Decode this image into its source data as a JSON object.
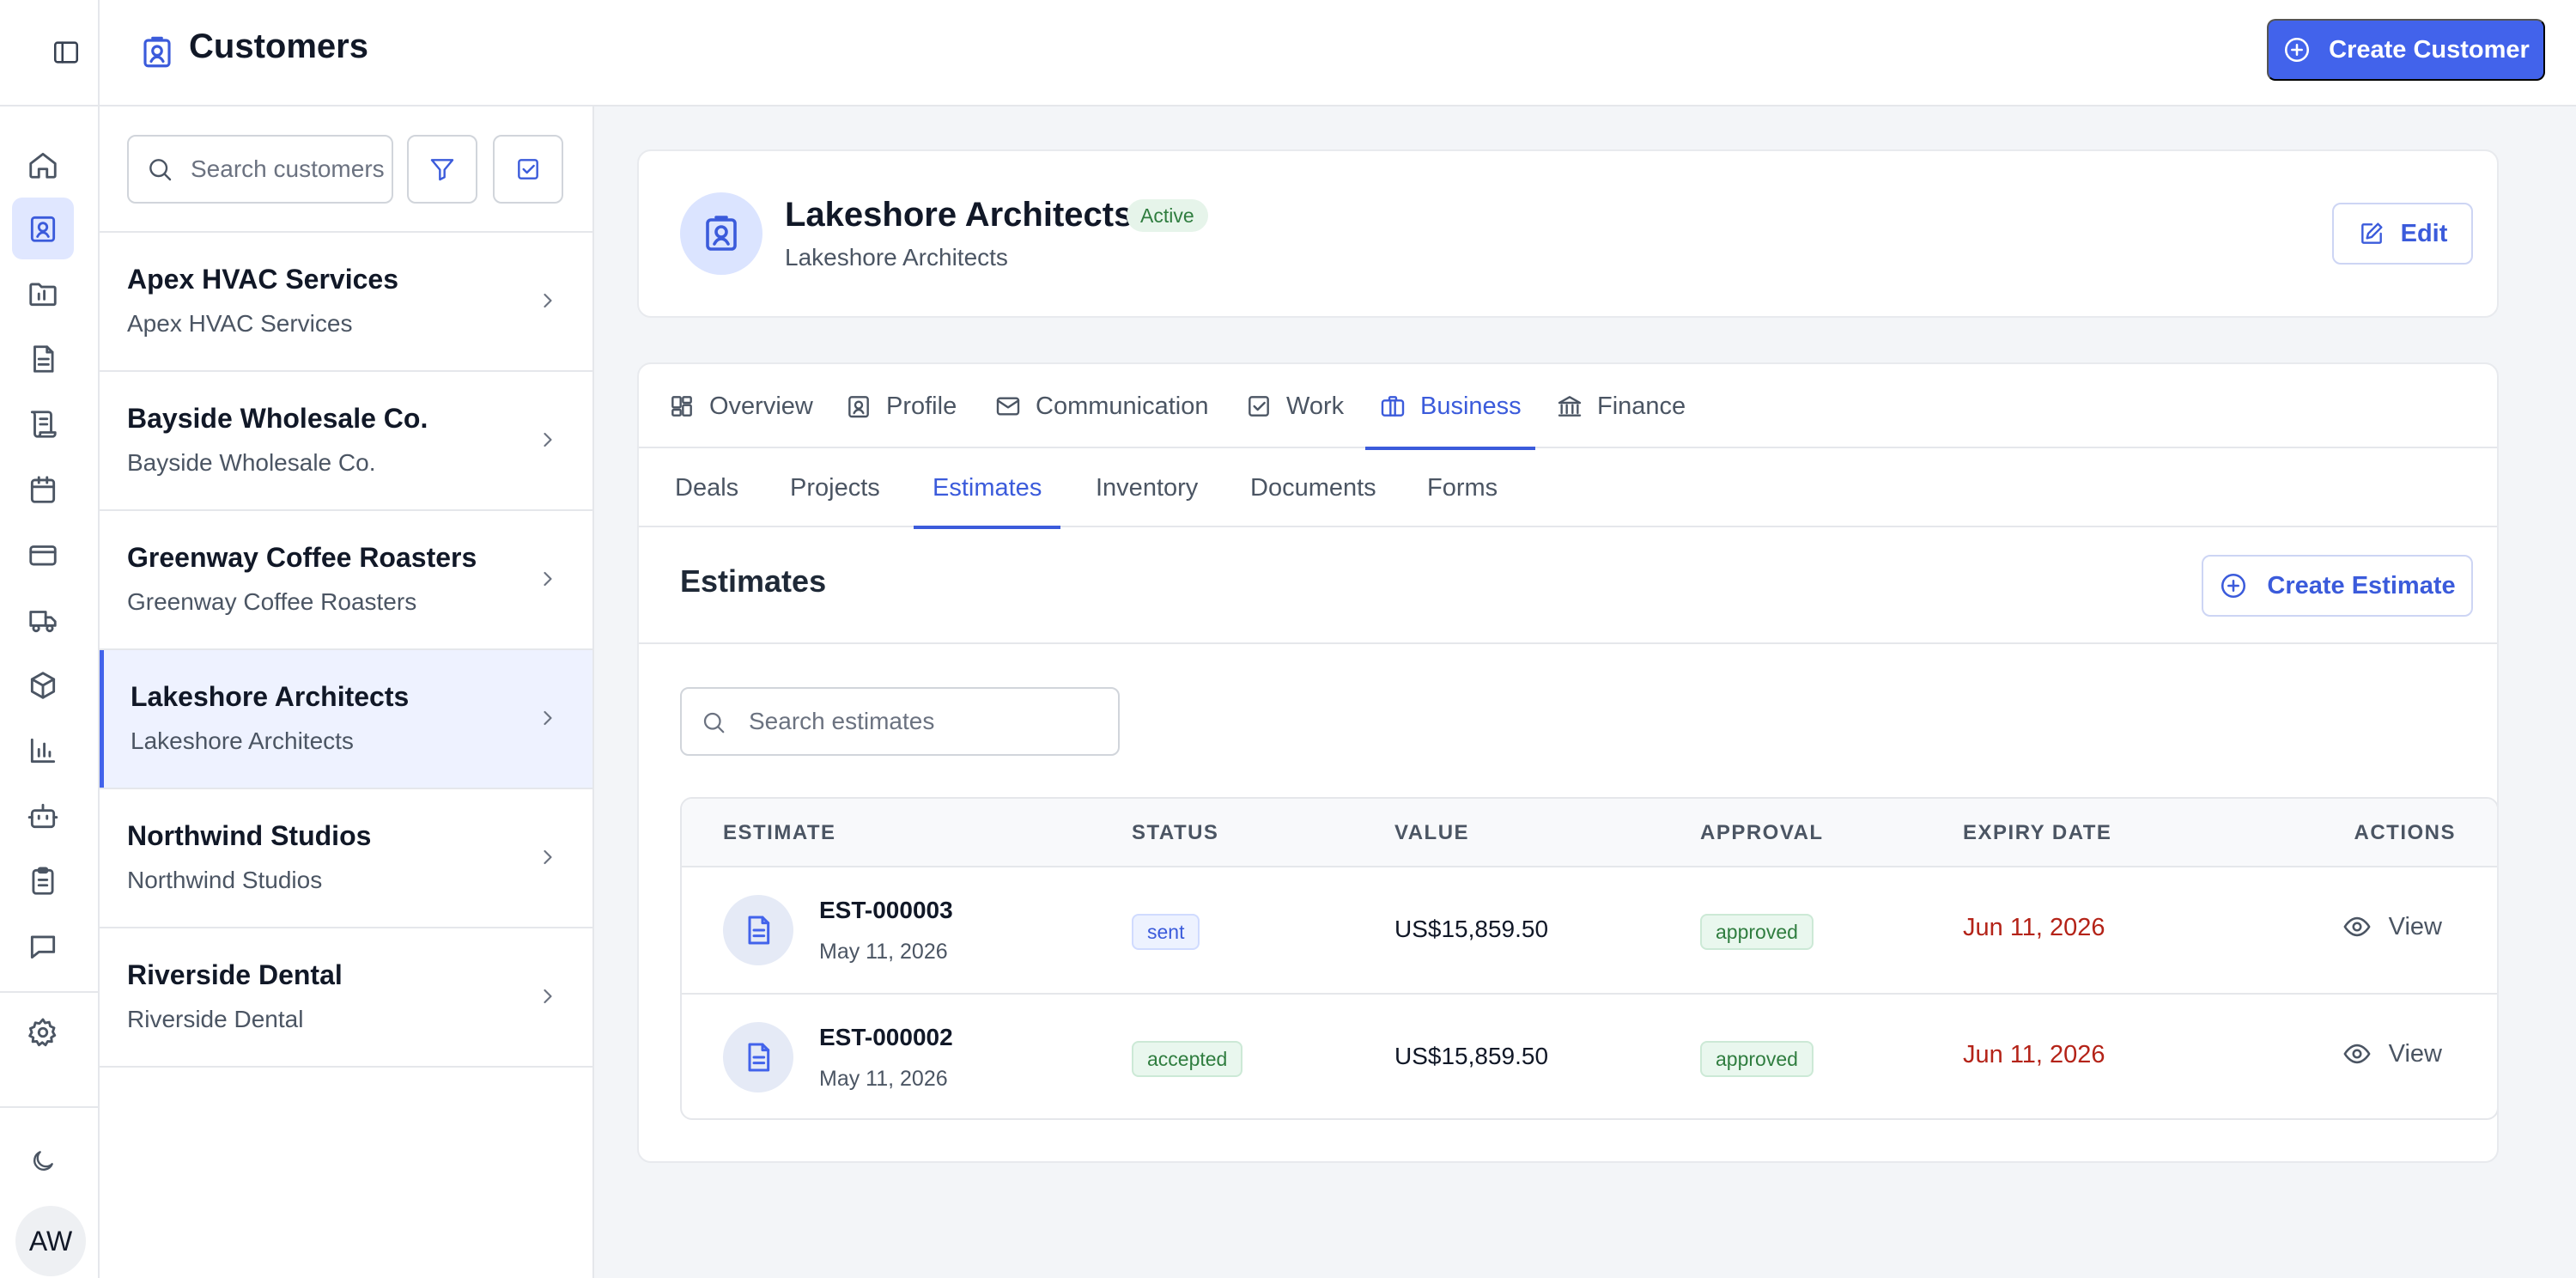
{
  "header": {
    "title": "Customers",
    "create_label": "Create Customer"
  },
  "rail": {
    "items": [
      "home",
      "customers",
      "projects",
      "documents",
      "contracts",
      "calendar",
      "billing",
      "delivery",
      "inventory",
      "reports",
      "automation",
      "tasks",
      "messages"
    ],
    "active": "customers",
    "settings": "settings",
    "theme": "moon-icon",
    "avatar_initials": "AW"
  },
  "customer_list": {
    "search_placeholder": "Search customers",
    "items": [
      {
        "name": "Apex HVAC Services",
        "sub": "Apex HVAC Services"
      },
      {
        "name": "Bayside Wholesale Co.",
        "sub": "Bayside Wholesale Co."
      },
      {
        "name": "Greenway Coffee Roasters",
        "sub": "Greenway Coffee Roasters"
      },
      {
        "name": "Lakeshore Architects",
        "sub": "Lakeshore Architects",
        "active": true
      },
      {
        "name": "Northwind Studios",
        "sub": "Northwind Studios"
      },
      {
        "name": "Riverside Dental",
        "sub": "Riverside Dental"
      }
    ]
  },
  "customer": {
    "name": "Lakeshore Architects",
    "status": "Active",
    "sub": "Lakeshore Architects",
    "edit_label": "Edit"
  },
  "tabs": [
    "Overview",
    "Profile",
    "Communication",
    "Work",
    "Business",
    "Finance"
  ],
  "active_tab": "Business",
  "subtabs": [
    "Deals",
    "Projects",
    "Estimates",
    "Inventory",
    "Documents",
    "Forms"
  ],
  "active_subtab": "Estimates",
  "estimates": {
    "title": "Estimates",
    "create_label": "Create Estimate",
    "search_placeholder": "Search estimates",
    "columns": [
      "ESTIMATE",
      "STATUS",
      "VALUE",
      "APPROVAL",
      "EXPIRY DATE",
      "ACTIONS"
    ],
    "rows": [
      {
        "id": "EST-000003",
        "date": "May 11, 2026",
        "status": "sent",
        "value": "US$15,859.50",
        "approval": "approved",
        "expiry": "Jun 11, 2026",
        "action": "View"
      },
      {
        "id": "EST-000002",
        "date": "May 11, 2026",
        "status": "accepted",
        "value": "US$15,859.50",
        "approval": "approved",
        "expiry": "Jun 11, 2026",
        "action": "View"
      }
    ]
  },
  "colors": {
    "accent": "#4263eb",
    "success": "#2f7d3f",
    "danger": "#b42318"
  }
}
